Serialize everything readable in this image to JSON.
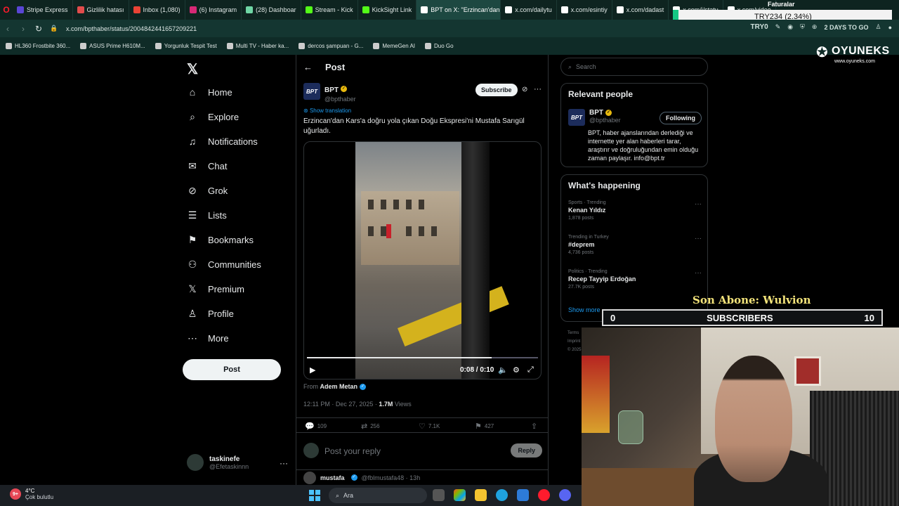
{
  "browser": {
    "tabs": [
      {
        "label": "Stripe Express",
        "color": "#5a46d6"
      },
      {
        "label": "Gizlilik hatası",
        "color": "#e14c4c"
      },
      {
        "label": "Inbox (1,080)",
        "color": "#ea4335"
      },
      {
        "label": "(6) Instagram",
        "color": "#d62976"
      },
      {
        "label": "(28) Dashboar",
        "color": "#6fd6a5"
      },
      {
        "label": "Stream - Kick",
        "color": "#53fc18"
      },
      {
        "label": "KickSight Link",
        "color": "#53fc18"
      },
      {
        "label": "BPT on X: \"Erzincan'dan",
        "color": "#ffffff",
        "active": true
      },
      {
        "label": "x.com/dailytu",
        "color": "#ffffff"
      },
      {
        "label": "x.com/esintiy",
        "color": "#ffffff"
      },
      {
        "label": "x.com/dadast",
        "color": "#ffffff"
      },
      {
        "label": "x.com/i/statu",
        "color": "#ffffff"
      },
      {
        "label": "x.com/video",
        "color": "#ffffff"
      }
    ],
    "url": "x.com/bpthaber/status/2004842441657209221",
    "toolbar_right": {
      "currency": "TRY0",
      "promo": "2 DAYS TO GO"
    },
    "bookmarks": [
      "HL360 Frostbite 360...",
      "ASUS Prime H610M...",
      "Yorgunluk Tespit Test",
      "Multi TV - Haber ka...",
      "dercos şampuan - G...",
      "MemeGen AI",
      "Duo Go"
    ]
  },
  "nav": {
    "items": [
      "Home",
      "Explore",
      "Notifications",
      "Chat",
      "Grok",
      "Lists",
      "Bookmarks",
      "Communities",
      "Premium",
      "Profile",
      "More"
    ],
    "icons": [
      "home-icon",
      "search-icon",
      "bell-icon",
      "mail-icon",
      "grok-icon",
      "list-icon",
      "bookmark-icon",
      "communities-icon",
      "x-icon",
      "person-icon",
      "more-circle-icon"
    ],
    "post_button": "Post",
    "account": {
      "name": "taskinefe",
      "handle": "@Efetaskinnn"
    }
  },
  "main": {
    "title": "Post",
    "author": {
      "name": "BPT",
      "handle": "@bpthaber",
      "avatar_text": "BPT"
    },
    "subscribe_label": "Subscribe",
    "show_translation": "Show translation",
    "text": "Erzincan'dan Kars'a doğru yola çıkan Doğu Ekspresi'ni Mustafa Sarıgül uğurladı.",
    "video": {
      "time": "0:08 / 0:10",
      "progress": 0.8
    },
    "from_label": "From",
    "from_name": "Adem Metan",
    "meta": {
      "time": "12:11 PM · Dec 27, 2025 · ",
      "views_count": "1.7M",
      "views_label": " Views"
    },
    "actions": {
      "replies": "109",
      "reposts": "256",
      "likes": "7.1K",
      "bookmarks": "427"
    },
    "reply_placeholder": "Post your reply",
    "reply_button": "Reply",
    "next_post": {
      "name": "mustafa",
      "handle": "@fblmustafa48 · 13h"
    }
  },
  "sidebar": {
    "search_placeholder": "Search",
    "relevant_title": "Relevant people",
    "relevant_user": {
      "name": "BPT",
      "handle": "@bpthaber",
      "follow_label": "Following",
      "bio": "BPT, haber ajanslarından derlediği ve internette yer alan haberleri tarar, araştırır ve doğruluğundan emin olduğu zaman paylaşır. info@bpt.tr"
    },
    "trending_title": "What's happening",
    "trends": [
      {
        "category": "Sports · Trending",
        "name": "Kenan Yıldız",
        "posts": "1,878 posts"
      },
      {
        "category": "Trending in Turkey",
        "name": "#deprem",
        "posts": "4,736 posts"
      },
      {
        "category": "Politics · Trending",
        "name": "Recep Tayyip Erdoğan",
        "posts": "27.7K posts"
      }
    ],
    "show_more": "Show more",
    "footer": [
      "Terms",
      "Imprint",
      "© 2025"
    ]
  },
  "overlays": {
    "brand": "OYUNEKS",
    "brand_url": "www.oyuneks.com",
    "faturalar": "Faturalar",
    "ticker": "TRY234 (2.34%)",
    "son_abone": "Son Abone: Wulvion",
    "subs": {
      "left": "0",
      "label": "SUBSCRIBERS",
      "right": "10"
    }
  },
  "taskbar": {
    "weather_temp": "4°C",
    "weather_desc": "Çok bulutlu",
    "weather_badge": "9+",
    "search_placeholder": "Ara"
  },
  "colors": {
    "accent": "#1d9bf0",
    "background": "#000000",
    "gold_badge": "#e8b90e",
    "browser_chrome": "#143631"
  }
}
